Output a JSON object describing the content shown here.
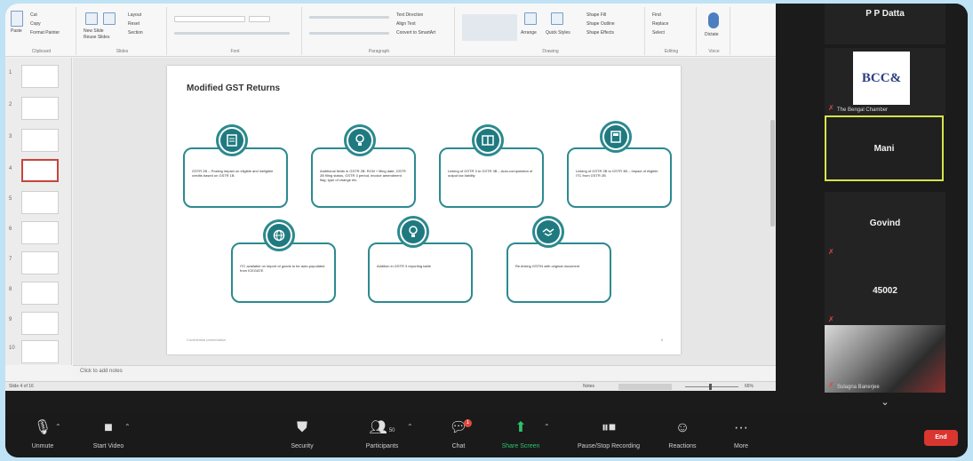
{
  "slide": {
    "title": "Modified GST Returns",
    "footer": "Confidential presentation",
    "page_number": "8",
    "cards_top": [
      {
        "icon": "document-icon",
        "text": "GSTR 2B – Posting impact on eligible and ineligible credits based on GSTR 1B"
      },
      {
        "icon": "bulb-icon",
        "text": "Additional fields in GSTR 2B: RCM + filing date, GSTR 2B filing status, GSTR 3 period, invoice amendment flag, type of change etc."
      },
      {
        "icon": "book-icon",
        "text": "Linking of GSTR 3 to GSTR 3B – Auto-computation of output tax liability"
      },
      {
        "icon": "calculator-icon",
        "text": "Linking of GSTR 2B to GSTR 3B – Impact of eligible ITC from GSTR 2B"
      }
    ],
    "cards_bottom": [
      {
        "icon": "globe-icon",
        "text": "ITC available on import of goods to be auto-populated from ICEGATE"
      },
      {
        "icon": "bulb-icon",
        "text": "Addition in GSTR 3 reporting table"
      },
      {
        "icon": "handshake-icon",
        "text": "Re-linking GSTIN with original document"
      }
    ]
  },
  "notes_placeholder": "Click to add notes",
  "ppt_status": {
    "left": "Slide 4 of 16",
    "notes": "Notes",
    "zoom": "66%"
  },
  "ribbon": {
    "clipboard": {
      "cut": "Cut",
      "copy": "Copy",
      "format_painter": "Format Painter",
      "paste": "Paste",
      "label": "Clipboard"
    },
    "slides": {
      "new_slide": "New Slide",
      "reuse": "Reuse Slides",
      "layout": "Layout",
      "reset": "Reset",
      "section": "Section",
      "label": "Slides"
    },
    "font": {
      "label": "Font"
    },
    "paragraph": {
      "text_direction": "Text Direction",
      "align_text": "Align Text",
      "smartart": "Convert to SmartArt",
      "label": "Paragraph"
    },
    "drawing": {
      "arrange": "Arrange",
      "quick_styles": "Quick Styles",
      "shape_fill": "Shape Fill",
      "shape_outline": "Shape Outline",
      "shape_effects": "Shape Effects",
      "label": "Drawing"
    },
    "editing": {
      "find": "Find",
      "replace": "Replace",
      "select": "Select",
      "label": "Editing"
    },
    "voice": {
      "dictate": "Dictate",
      "label": "Voice"
    }
  },
  "participants": [
    {
      "name": "P P Datta",
      "type": "name"
    },
    {
      "name": "The Bengal Chamber",
      "type": "logo",
      "logo_text": "BCC&"
    },
    {
      "name": "Mani",
      "type": "active"
    },
    {
      "name": "Govind",
      "type": "name"
    },
    {
      "name": "45002",
      "type": "name"
    },
    {
      "name": "Sulagna Banerjee",
      "type": "video"
    }
  ],
  "toolbar": {
    "unmute": "Unmute",
    "start_video": "Start Video",
    "security": "Security",
    "participants": "Participants",
    "participants_count": "50",
    "chat": "Chat",
    "chat_badge": "1",
    "share_screen": "Share Screen",
    "record": "Pause/Stop Recording",
    "reactions": "Reactions",
    "more": "More",
    "end": "End"
  },
  "colors": {
    "teal": "#2c8a8f",
    "active_border": "#d7e44a",
    "end_red": "#d9362f",
    "share_green": "#2ec26a"
  }
}
